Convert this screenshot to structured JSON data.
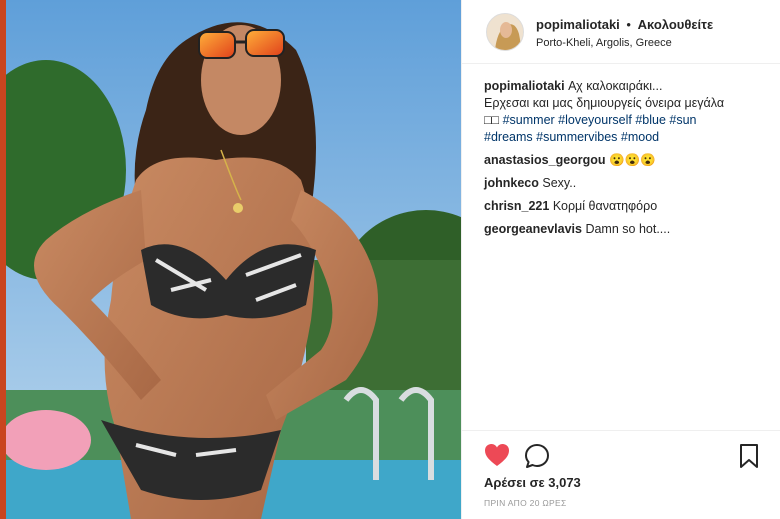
{
  "post": {
    "username": "popimaliotaki",
    "separator": "•",
    "follow_label": "Ακολουθείτε",
    "location": "Porto-Kheli, Argolis, Greece"
  },
  "caption": {
    "username": "popimaliotaki",
    "line1": "Αχ καλοκαιράκι...",
    "line2": "Ερχεσαι και μας δημιουργείς όνειρα μεγάλα",
    "line3_prefix": "□□",
    "hashtags_line3": [
      "#summer",
      "#loveyourself",
      "#blue",
      "#sun"
    ],
    "hashtags_line4": [
      "#dreams",
      "#summervibes",
      "#mood"
    ]
  },
  "comments": [
    {
      "username": "anastasios_georgou",
      "text": "😮😮😮"
    },
    {
      "username": "johnkeco",
      "text": "Sexy.."
    },
    {
      "username": "chrisn_221",
      "text": "Κορμί θανατηφόρο"
    },
    {
      "username": "georgeanevlavis",
      "text": "Damn so hot...."
    }
  ],
  "actions": {
    "like_icon": "heart-icon",
    "comment_icon": "comment-icon",
    "save_icon": "bookmark-icon",
    "liked": true
  },
  "likes_text": "Αρέσει σε 3,073",
  "timestamp": "ΠΡΙΝ ΑΠΟ 20 ΩΡΕΣ",
  "colors": {
    "heart": "#ed4956",
    "hashtag": "#003569",
    "text": "#262626",
    "muted": "#999999"
  }
}
